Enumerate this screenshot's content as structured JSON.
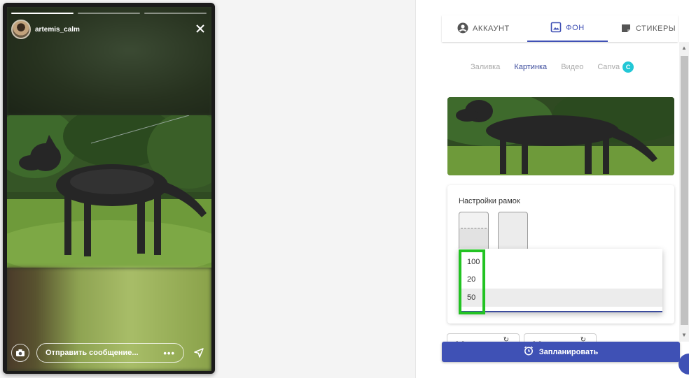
{
  "story": {
    "username": "artemis_calm",
    "message_placeholder": "Отправить сообщение...",
    "more_dots": "•••",
    "progress_segments": [
      1,
      0,
      0
    ]
  },
  "tabs": [
    {
      "label": "АККАУНТ",
      "icon": "account-circle-icon"
    },
    {
      "label": "ФОН",
      "icon": "image-frame-icon",
      "active": true
    },
    {
      "label": "СТИКЕРЫ",
      "icon": "sticker-icon"
    }
  ],
  "subtabs": [
    {
      "label": "Заливка"
    },
    {
      "label": "Картинка",
      "active": true
    },
    {
      "label": "Видео"
    },
    {
      "label": "Canva",
      "badge": "C"
    }
  ],
  "settings": {
    "title": "Настройки рамок"
  },
  "dropdown": {
    "options": [
      "100",
      "20",
      "50"
    ],
    "selected": "50"
  },
  "schedule_button": {
    "label": "Запланировать"
  },
  "colors": {
    "accent": "#3f51b5",
    "highlight": "#22c322",
    "canva": "#22c7d6"
  }
}
